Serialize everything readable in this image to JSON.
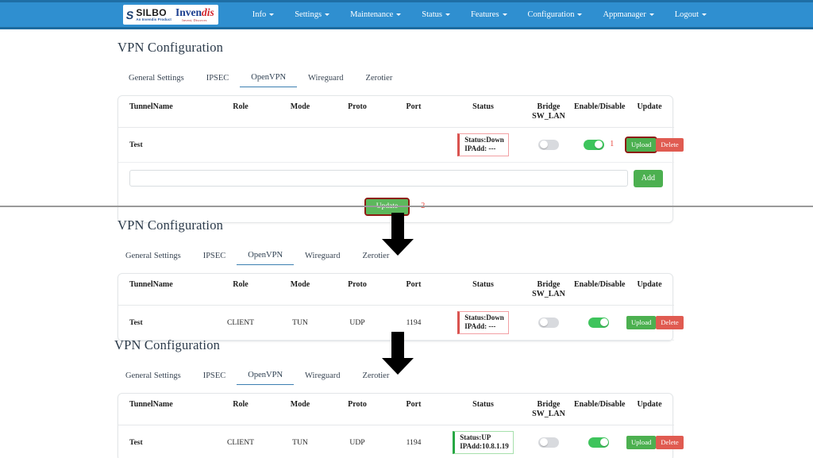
{
  "navbar": {
    "brand": {
      "silbo_name": "SILBO",
      "silbo_sub": "An Invendis Product",
      "invendis_a": "Inven",
      "invendis_b": "dis",
      "invendis_sub": "Invent, Discover."
    },
    "items": [
      {
        "label": "Info",
        "caret": true
      },
      {
        "label": "Settings",
        "caret": true
      },
      {
        "label": "Maintenance",
        "caret": true
      },
      {
        "label": "Status",
        "caret": true
      },
      {
        "label": "Features",
        "caret": true
      },
      {
        "label": "Configuration",
        "caret": true
      },
      {
        "label": "Appmanager",
        "caret": true
      },
      {
        "label": "Logout",
        "caret": true
      }
    ]
  },
  "colors": {
    "navbar_blue": "#2f8fd0",
    "accent_green": "#4cb050",
    "danger_red": "#e05b51",
    "annotation_red": "#e8443a",
    "status_down_border": "#d9534f",
    "status_up_border": "#27a844"
  },
  "tabs": [
    {
      "label": "General Settings",
      "active": false
    },
    {
      "label": "IPSEC",
      "active": false
    },
    {
      "label": "OpenVPN",
      "active": true
    },
    {
      "label": "Wireguard",
      "active": false
    },
    {
      "label": "Zerotier",
      "active": false
    }
  ],
  "table_headers": {
    "tunnel_name": "TunnelName",
    "role": "Role",
    "mode": "Mode",
    "proto": "Proto",
    "port": "Port",
    "status": "Status",
    "bridge_l1": "Bridge",
    "bridge_l2": "SW_LAN",
    "enable_disable": "Enable/Disable",
    "update": "Update"
  },
  "buttons": {
    "upload": "Upload",
    "delete": "Delete",
    "add": "Add",
    "update": "Update"
  },
  "panels": [
    {
      "title": "VPN Configuration",
      "row": {
        "tunnel_name": "Test",
        "role": "",
        "mode": "",
        "proto": "",
        "port": "",
        "status_line1": "Status:Down",
        "status_line2": "IPAdd: ---",
        "status_state": "down",
        "bridge_toggle": "off",
        "enable_toggle": "on",
        "annotation": "1"
      },
      "add_input_value": "",
      "add_input_placeholder": "",
      "update_annotation": "2"
    },
    {
      "title": "VPN Configuration",
      "row": {
        "tunnel_name": "Test",
        "role": "CLIENT",
        "mode": "TUN",
        "proto": "UDP",
        "port": "1194",
        "status_line1": "Status:Down",
        "status_line2": "IPAdd: ---",
        "status_state": "down",
        "bridge_toggle": "off",
        "enable_toggle": "on"
      }
    },
    {
      "title": "VPN Configuration",
      "row": {
        "tunnel_name": "Test",
        "role": "CLIENT",
        "mode": "TUN",
        "proto": "UDP",
        "port": "1194",
        "status_line1": "Status:UP",
        "status_line2": "IPAdd:10.8.1.19",
        "status_state": "up",
        "bridge_toggle": "off",
        "enable_toggle": "on"
      }
    }
  ]
}
